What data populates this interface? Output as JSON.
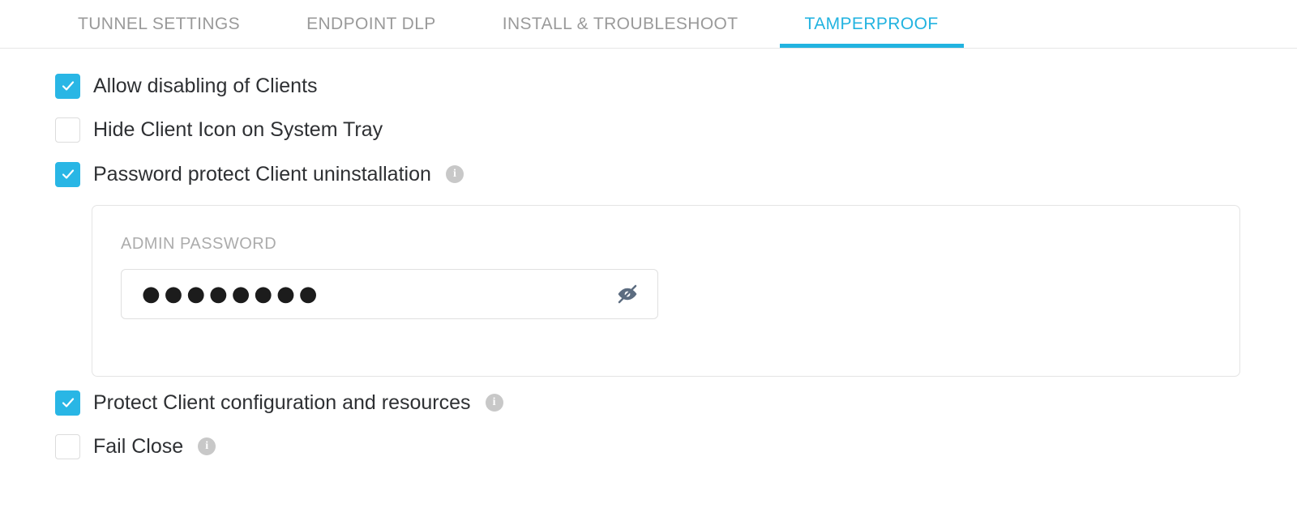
{
  "theme": {
    "accent": "#22b3e0",
    "checkbox_checked": "#29b6e5",
    "tab_inactive": "#9a9a9a",
    "label_text": "#2e3033",
    "muted_label": "#acacac",
    "border": "#e4e4e4",
    "info_icon_bg": "#c8c8c8",
    "eye_icon": "#5c6c80"
  },
  "tabs": [
    {
      "label": "TUNNEL SETTINGS",
      "active": false,
      "name": "tab-tunnel-settings"
    },
    {
      "label": "ENDPOINT DLP",
      "active": false,
      "name": "tab-endpoint-dlp"
    },
    {
      "label": "INSTALL & TROUBLESHOOT",
      "active": false,
      "name": "tab-install-troubleshoot"
    },
    {
      "label": "TAMPERPROOF",
      "active": true,
      "name": "tab-tamperproof"
    }
  ],
  "settings": {
    "allow_disabling_clients": {
      "label": "Allow disabling of Clients",
      "checked": true,
      "has_info": false
    },
    "hide_client_icon": {
      "label": "Hide Client Icon on System Tray",
      "checked": false,
      "has_info": false
    },
    "password_protect_uninstall": {
      "label": "Password protect Client uninstallation",
      "checked": true,
      "has_info": true,
      "info_glyph": "i"
    },
    "protect_client_config": {
      "label": "Protect Client configuration and resources",
      "checked": true,
      "has_info": true,
      "info_glyph": "i"
    },
    "fail_close": {
      "label": "Fail Close",
      "checked": false,
      "has_info": true,
      "info_glyph": "i"
    }
  },
  "password_panel": {
    "field_label": "ADMIN PASSWORD",
    "value_masked": "●●●●●●●●",
    "placeholder": "",
    "character_count": 8,
    "visibility_toggle": {
      "name": "toggle-password-visibility",
      "state": "hidden"
    }
  }
}
